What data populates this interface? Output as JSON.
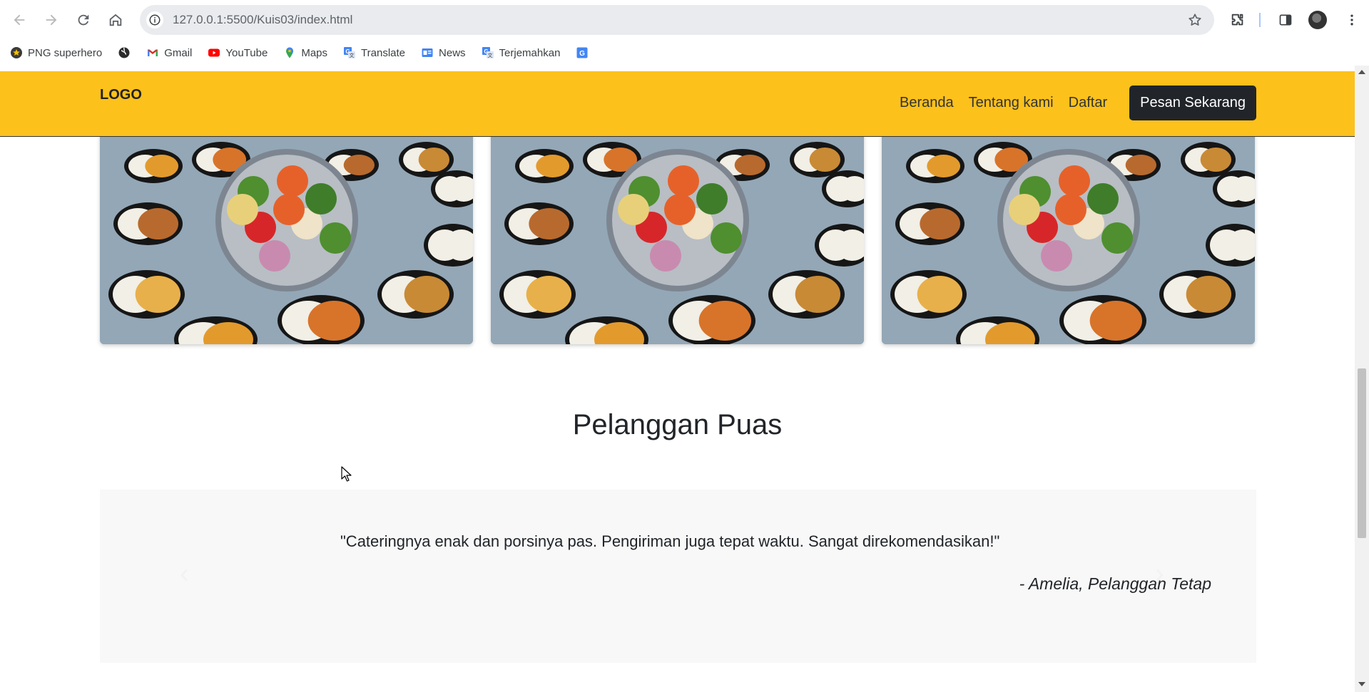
{
  "browser": {
    "url": "127.0.0.1:5500/Kuis03/index.html",
    "bookmarks": [
      {
        "label": "PNG superhero",
        "icon": "superhero-icon"
      },
      {
        "label": "",
        "icon": "globe-icon"
      },
      {
        "label": "Gmail",
        "icon": "gmail-icon"
      },
      {
        "label": "YouTube",
        "icon": "youtube-icon"
      },
      {
        "label": "Maps",
        "icon": "maps-icon"
      },
      {
        "label": "Translate",
        "icon": "translate-icon"
      },
      {
        "label": "News",
        "icon": "news-icon"
      },
      {
        "label": "Terjemahkan",
        "icon": "translate-icon"
      },
      {
        "label": "",
        "icon": "google-translate-icon"
      }
    ]
  },
  "site": {
    "logo": "LOGO",
    "nav": [
      "Beranda",
      "Tentang kami",
      "Daftar"
    ],
    "cta": "Pesan Sekarang",
    "brand_color": "#fcc11b"
  },
  "testimonials": {
    "title": "Pelanggan Puas",
    "quote": "\"Cateringnya enak dan porsinya pas. Pengiriman juga tepat waktu. Sangat direkomendasikan!\"",
    "author": "- Amelia, Pelanggan Tetap",
    "prev_icon": "chevron-left-icon",
    "next_icon": "chevron-right-icon"
  }
}
